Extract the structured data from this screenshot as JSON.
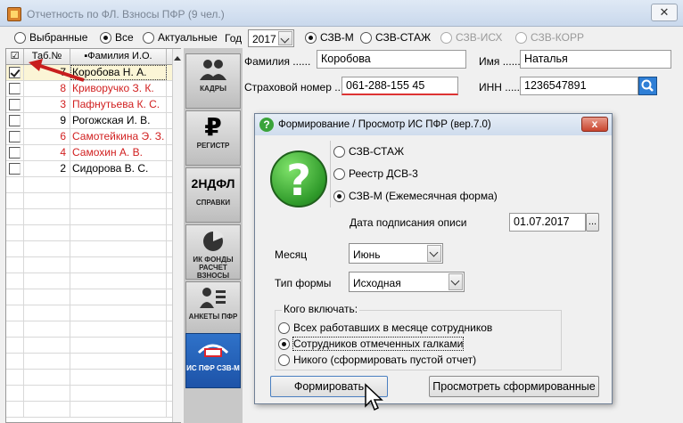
{
  "window": {
    "title": "Отчетность по ФЛ. Взносы ПФР (9 чел.)",
    "close_glyph": "✕"
  },
  "filter": {
    "options": [
      {
        "label": "Выбранные",
        "selected": false
      },
      {
        "label": "Все",
        "selected": true
      },
      {
        "label": "Актуальные",
        "selected": false
      }
    ],
    "year_label": "Год",
    "year_value": "2017",
    "forms": [
      {
        "label": "СЗВ-М",
        "selected": true,
        "enabled": true
      },
      {
        "label": "СЗВ-СТАЖ",
        "selected": false,
        "enabled": true
      },
      {
        "label": "СЗВ-ИСХ",
        "selected": false,
        "enabled": false
      },
      {
        "label": "СЗВ-КОРР",
        "selected": false,
        "enabled": false
      }
    ]
  },
  "employees": {
    "columns": [
      "☑",
      "Таб.№",
      "▪Фамилия И.О."
    ],
    "rows": [
      {
        "tab": "7",
        "name": "Коробова Н. А.",
        "checked": true,
        "red": false
      },
      {
        "tab": "8",
        "name": "Криворучко З. К.",
        "checked": false,
        "red": true
      },
      {
        "tab": "3",
        "name": "Пафнутьева К. С.",
        "checked": false,
        "red": true
      },
      {
        "tab": "9",
        "name": "Рогожская И. В.",
        "checked": false,
        "red": false
      },
      {
        "tab": "6",
        "name": "Самотейкина Э. З.",
        "checked": false,
        "red": true
      },
      {
        "tab": "4",
        "name": "Самохин А. В.",
        "checked": false,
        "red": true
      },
      {
        "tab": "2",
        "name": "Сидорова В. С.",
        "checked": false,
        "red": false
      }
    ]
  },
  "nav": [
    {
      "label": "КАДРЫ",
      "icon": "people-icon"
    },
    {
      "label": "РЕГИСТР",
      "icon": "ruble-icon"
    },
    {
      "label": "СПРАВКИ",
      "icon": "2ndfl-icon",
      "big": "2НДФЛ"
    },
    {
      "label": "ИК ФОНДЫ РАСЧЕТ ВЗНОСЫ",
      "icon": "pie-chart-icon"
    },
    {
      "label": "АНКЕТЫ ПФР",
      "icon": "person-list-icon"
    },
    {
      "label": "ИС ПФР СЗВ-М",
      "icon": "pfr-logo-icon"
    }
  ],
  "person": {
    "surname_label": "Фамилия ......",
    "surname": "Коробова",
    "name_label": "Имя .......",
    "name": "Наталья",
    "snils_label": "Страховой номер ..",
    "snils": "061-288-155 45",
    "inn_label": "ИНН ........",
    "inn": "1236547891"
  },
  "dialog": {
    "title": "Формирование / Просмотр ИС ПФР (вер.7.0)",
    "close": "x",
    "icon_glyph": "?",
    "report_types": [
      {
        "label": "СЗВ-СТАЖ",
        "selected": false
      },
      {
        "label": "Реестр ДСВ-3",
        "selected": false
      },
      {
        "label": "СЗВ-М (Ежемесячная форма)",
        "selected": true
      }
    ],
    "sign_date_label": "Дата подписания описи",
    "sign_date": "01.07.2017",
    "date_button": "...",
    "month_label": "Месяц",
    "month_value": "Июнь",
    "form_type_label": "Тип формы",
    "form_type_value": "Исходная",
    "include_caption": "Кого включать:",
    "include_options": [
      {
        "label": "Всех работавших в месяце сотрудников",
        "selected": false
      },
      {
        "label": "Сотрудников отмеченных галками",
        "selected": true
      },
      {
        "label": "Никого (сформировать пустой отчет)",
        "selected": false
      }
    ],
    "generate_button": "Формировать",
    "view_button": "Просмотреть сформированные"
  },
  "colors": {
    "red_name": "#d12020",
    "active_nav": "#1d53a8",
    "accent_green": "#2f9a2a"
  }
}
